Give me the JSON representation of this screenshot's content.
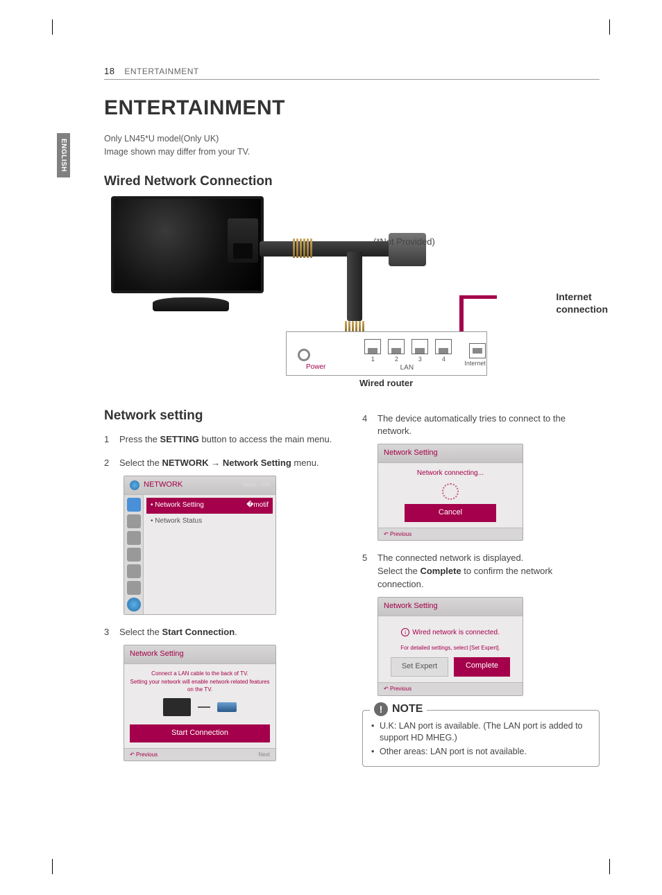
{
  "header": {
    "page_number": "18",
    "section": "ENTERTAINMENT",
    "side_tab": "ENGLISH"
  },
  "title": "ENTERTAINMENT",
  "subtitle_lines": {
    "l1": "Only LN45*U model(Only UK)",
    "l2": "Image shown may differ from your TV."
  },
  "h2_wired": "Wired Network Connection",
  "diagram": {
    "not_provided": "(*Not Provided)",
    "internet_label_l1": "Internet",
    "internet_label_l2": "connection",
    "router_caption": "Wired router",
    "power": "Power",
    "lan": "LAN",
    "internet": "Internet",
    "ports": [
      "1",
      "2",
      "3",
      "4"
    ]
  },
  "h3_network": "Network setting",
  "steps_left": {
    "s1_a": "Press the ",
    "s1_b": "SETTING",
    "s1_c": " button to access the main menu.",
    "s2_a": "Select the ",
    "s2_b": "NETWORK",
    "s2_arrow": " → ",
    "s2_c": "Network Setting",
    "s2_d": " menu.",
    "s3_a": "Select the ",
    "s3_b": "Start Connection",
    "s3_c": "."
  },
  "osd_network_menu": {
    "title": "NETWORK",
    "hint_move": "Move",
    "hint_ok": "OK",
    "item_sel": "Network Setting",
    "item2": "Network Status"
  },
  "osd_start": {
    "title": "Network Setting",
    "line1": "Connect a LAN cable to the back of TV.",
    "line2": "Setting your network will enable network-related features on the TV.",
    "btn": "Start Connection",
    "prev": "Previous",
    "next": "Next"
  },
  "steps_right": {
    "s4": "The device automatically tries to connect to the network.",
    "s5_a": "The connected network is displayed.",
    "s5_b_a": "Select the ",
    "s5_b_b": "Complete",
    "s5_b_c": " to confirm the network connection."
  },
  "osd_connecting": {
    "title": "Network Setting",
    "msg": "Network connecting...",
    "cancel": "Cancel",
    "prev": "Previous"
  },
  "osd_connected": {
    "title": "Network Setting",
    "msg": "Wired network is connected.",
    "hint": "For detailed settings, select [Set Expert].",
    "btn_expert": "Set Expert",
    "btn_complete": "Complete",
    "prev": "Previous"
  },
  "note": {
    "label": "NOTE",
    "li1": "U.K: LAN port is available. (The LAN port is added to support HD MHEG.)",
    "li2": "Other areas: LAN port is not available."
  }
}
